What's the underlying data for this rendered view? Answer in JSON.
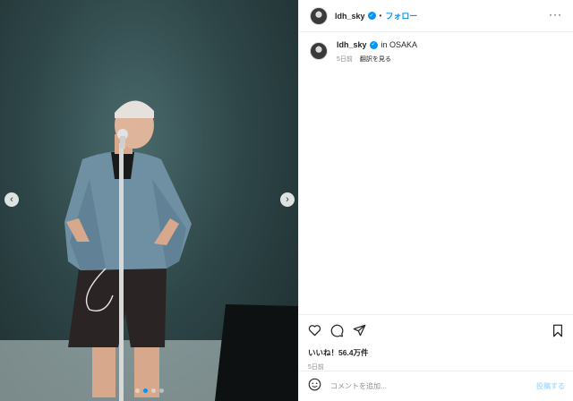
{
  "media": {
    "carousel_dots": 4,
    "active_dot": 1
  },
  "header": {
    "username": "ldh_sky",
    "separator": "•",
    "follow_label": "フォロー",
    "more_label": "···"
  },
  "caption": {
    "username": "ldh_sky",
    "text": "in OSAKA",
    "time_ago": "5日前",
    "translate_label": "翻訳を見る"
  },
  "actions": {
    "likes_text": "いいね！56.4万件",
    "date_text": "5日前"
  },
  "comment": {
    "placeholder": "コメントを追加...",
    "post_label": "投稿する"
  },
  "colors": {
    "accent": "#0095f6",
    "muted": "#8e8e8e",
    "post_disabled": "#b2dffc"
  }
}
